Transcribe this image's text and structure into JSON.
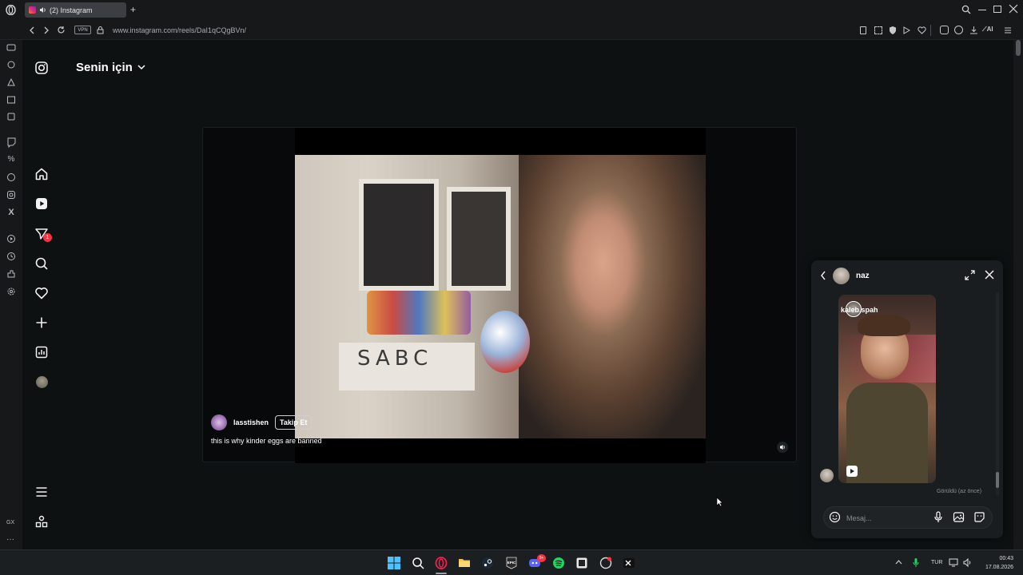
{
  "browser": {
    "tab_title": "(2) Instagram",
    "url": "www.instagram.com/reels/DaI1qCQgBVn/",
    "vpn_label": "VPN",
    "ai_label": "AI",
    "gx_label": "GX",
    "sidebar_icons": [
      "messenger-icon",
      "refresh-icon",
      "flow-icon",
      "pinboard-icon",
      "music-icon",
      "twitch-icon",
      "percent-icon",
      "whatsapp-icon",
      "instagram-icon",
      "x-icon",
      "player-icon",
      "history-icon",
      "extensions-icon",
      "settings-icon"
    ]
  },
  "instagram": {
    "feed_title": "Senin için",
    "nav_icons": [
      "home-icon",
      "reels-icon",
      "messages-icon",
      "search-icon",
      "notifications-icon",
      "create-icon",
      "dashboard-icon",
      "profile-icon",
      "menu-icon",
      "more-icon"
    ],
    "messages_badge": "1",
    "reel": {
      "username": "lasstishen",
      "follow_label": "Takip Et",
      "caption": "this is why kinder eggs are banned"
    }
  },
  "chat": {
    "contact_name": "naz",
    "shared_post_user": "kaleb.spah",
    "seen_label": "Görüldü (az önce)",
    "message_placeholder": "Mesaj..."
  },
  "taskbar": {
    "language": "TUR",
    "time": "00:43",
    "date": "17.08.2026",
    "discord_badge": "9+",
    "app_icons": [
      "windows-start-icon",
      "search-icon",
      "opera-gx-icon",
      "file-explorer-icon",
      "steam-icon",
      "epic-games-icon",
      "discord-icon",
      "spotify-icon",
      "app-icon",
      "app-icon-2",
      "terminal-icon"
    ]
  },
  "colors": {
    "accent_red": "#ff3040",
    "background": "#0d1112",
    "chat_bg": "#1a1d20"
  }
}
